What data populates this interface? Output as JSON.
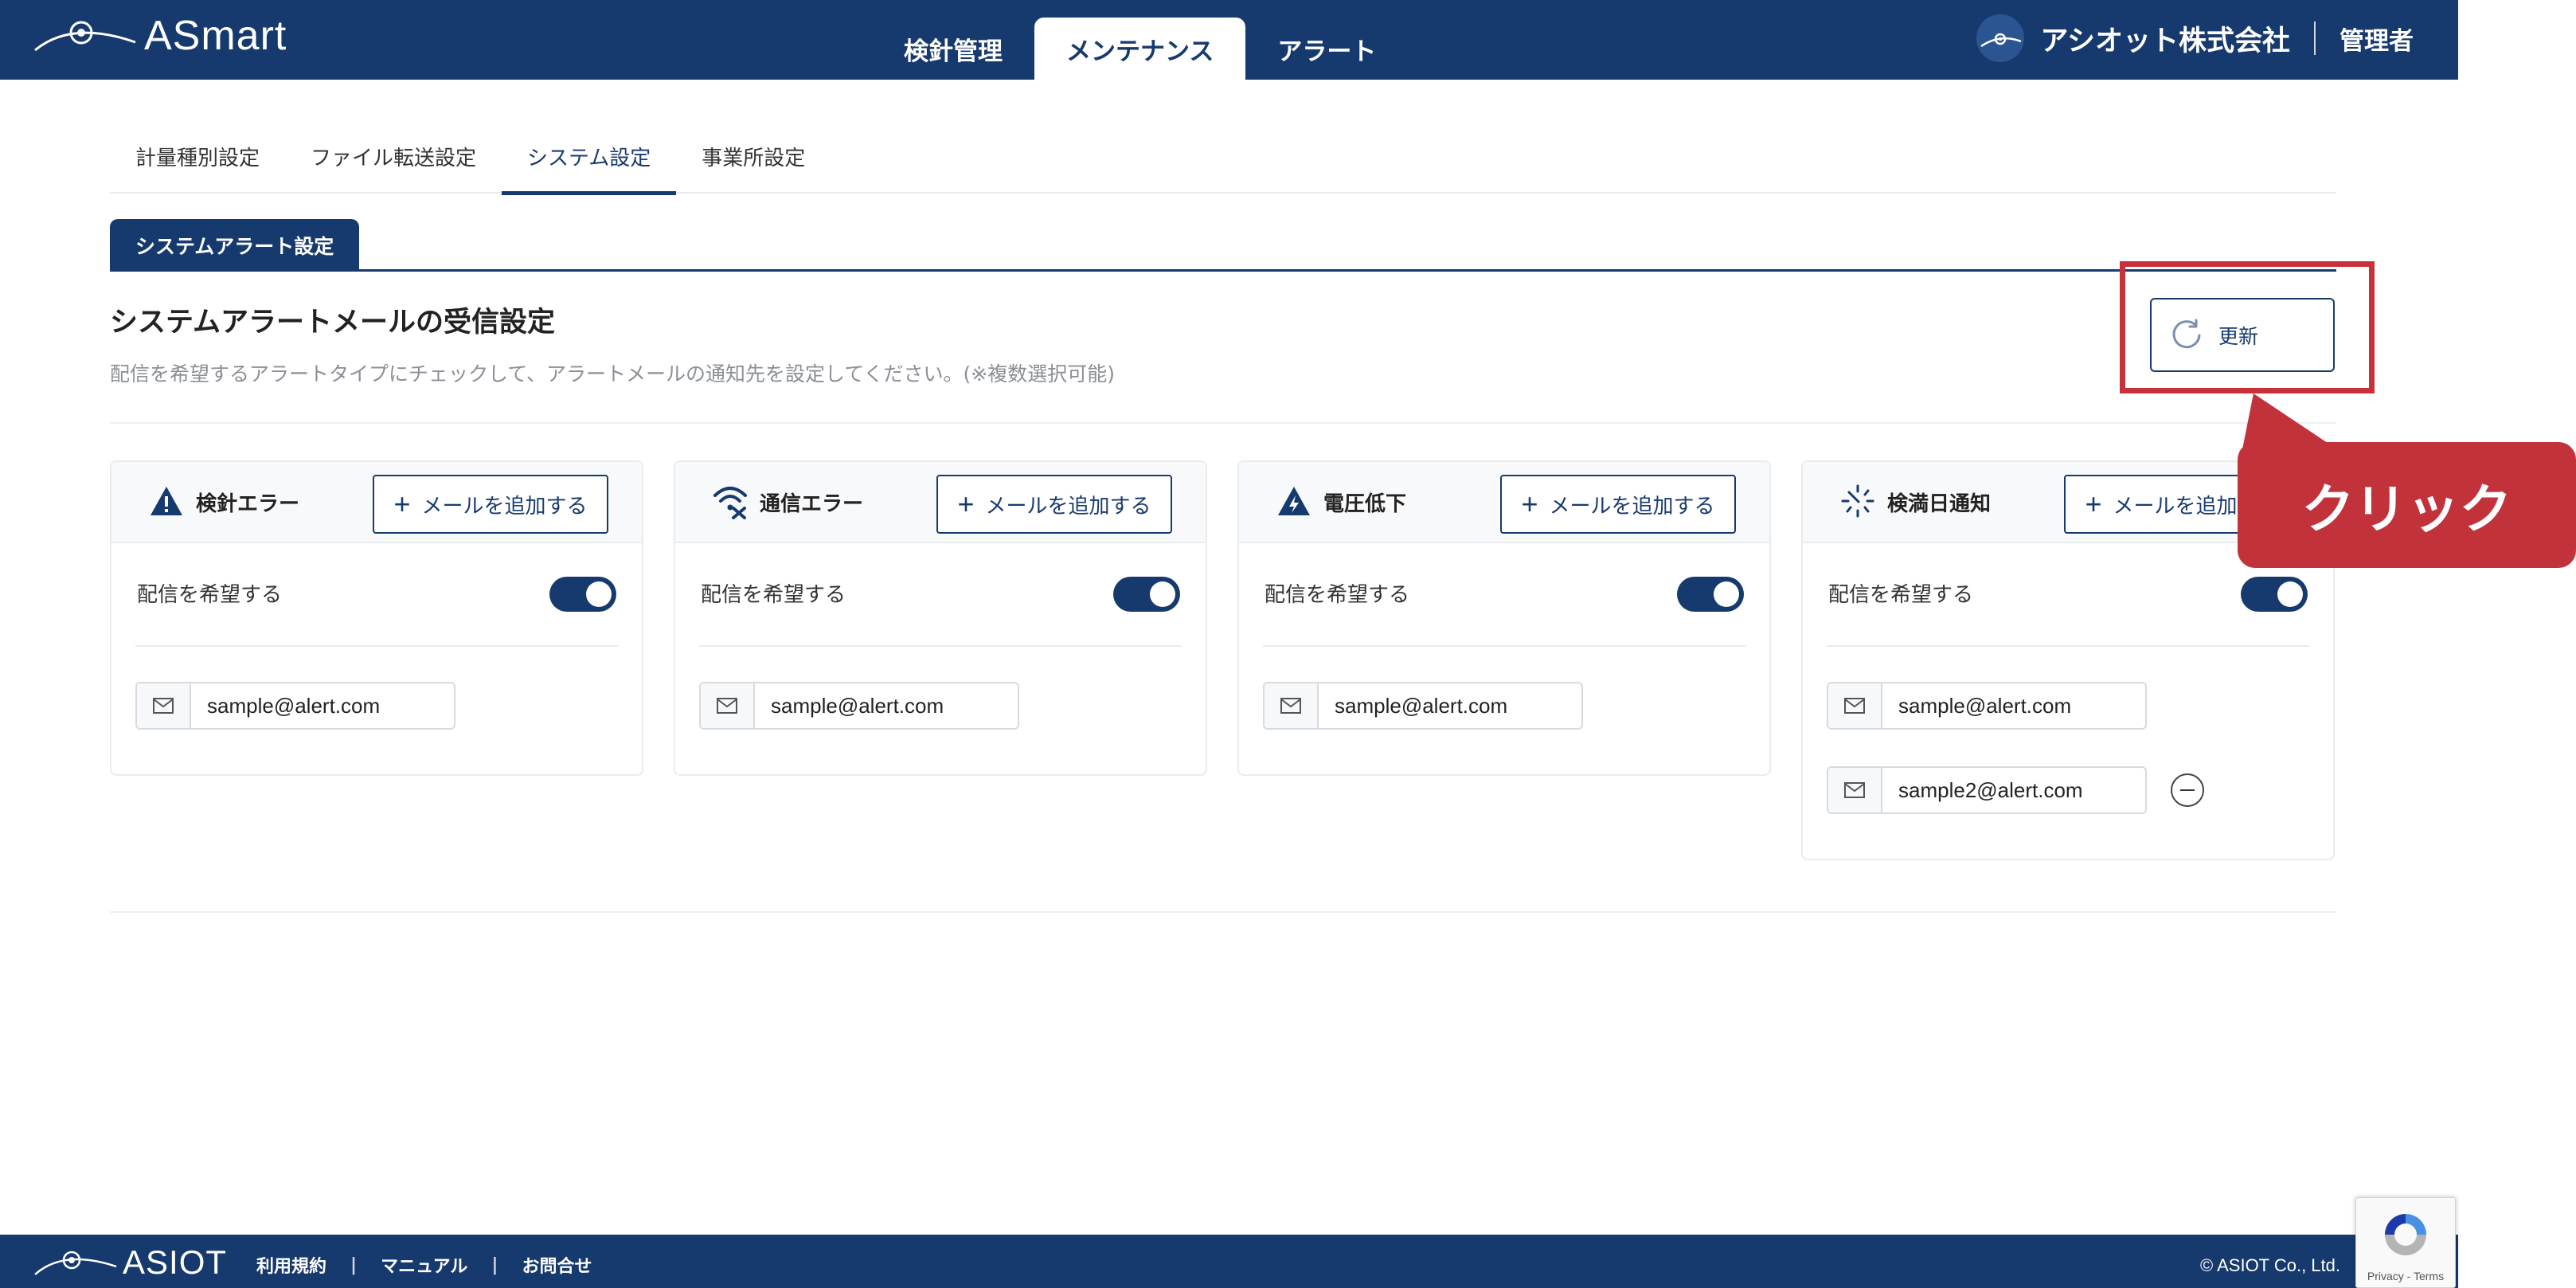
{
  "header": {
    "brand_name": "ASmart",
    "main_tabs": [
      {
        "label": "検針管理",
        "active": false
      },
      {
        "label": "メンテナンス",
        "active": true
      },
      {
        "label": "アラート",
        "active": false
      }
    ],
    "company_name": "アシオット株式会社",
    "user_role": "管理者"
  },
  "sub_tabs": [
    {
      "label": "計量種別設定",
      "active": false
    },
    {
      "label": "ファイル転送設定",
      "active": false
    },
    {
      "label": "システム設定",
      "active": true
    },
    {
      "label": "事業所設定",
      "active": false
    }
  ],
  "section": {
    "tab_label": "システムアラート設定",
    "title": "システムアラートメールの受信設定",
    "description": "配信を希望するアラートタイプにチェックして、アラートメールの通知先を設定してください。(※複数選択可能)",
    "refresh_label": "更新"
  },
  "alert_cards": [
    {
      "title": "検針エラー",
      "icon": "warning-triangle-icon",
      "add_label": "メールを追加する",
      "pref_label": "配信を希望する",
      "enabled": true,
      "emails": [
        "sample@alert.com"
      ]
    },
    {
      "title": "通信エラー",
      "icon": "wifi-off-icon",
      "add_label": "メールを追加する",
      "pref_label": "配信を希望する",
      "enabled": true,
      "emails": [
        "sample@alert.com"
      ]
    },
    {
      "title": "電圧低下",
      "icon": "voltage-warning-icon",
      "add_label": "メールを追加する",
      "pref_label": "配信を希望する",
      "enabled": true,
      "emails": [
        "sample@alert.com"
      ]
    },
    {
      "title": "検満日通知",
      "icon": "timer-icon",
      "add_label": "メールを追加する",
      "pref_label": "配信を希望する",
      "enabled": true,
      "emails": [
        "sample@alert.com",
        "sample2@alert.com"
      ]
    }
  ],
  "callout": {
    "label": "クリック",
    "color": "#c2323b"
  },
  "footer": {
    "brand_name": "ASIOT",
    "links": [
      "利用規約",
      "マニュアル",
      "お問合せ"
    ],
    "copyright": "© ASIOT Co., Ltd."
  },
  "recaptcha": {
    "label": "Privacy - Terms"
  },
  "colors": {
    "primary": "#173a6e",
    "highlight": "#c8303a"
  }
}
